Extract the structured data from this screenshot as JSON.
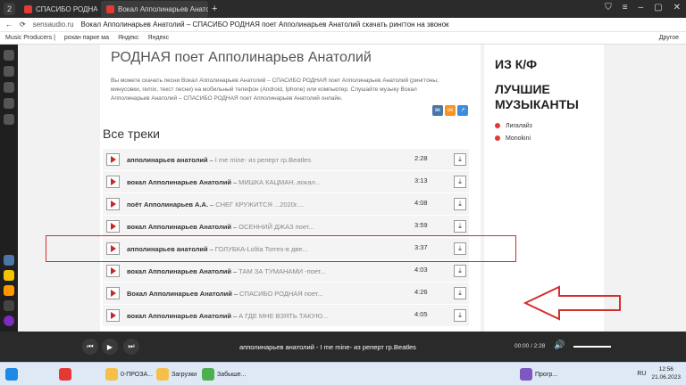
{
  "browser": {
    "tab_count": "2",
    "tabs": [
      {
        "title": "СПАСИБО РОДНАЯ поет Апполинарьев..."
      },
      {
        "title": "Вокал Апполинарьев Анатолий"
      }
    ],
    "address": {
      "host": "sensaudio.ru",
      "title": "Вокал Апполинарьев Анатолий – СПАСИБО РОДНАЯ поет Апполинарьев Анатолий скачать рингтон на звонок"
    },
    "bookmarks": [
      "Music Producers |",
      "рохан парке ма",
      "Яндекс",
      "Яндекс"
    ],
    "bookmarks_other": "Другое"
  },
  "page": {
    "heading": "РОДНАЯ поет Апполинарьев Анатолий",
    "description": "Вы можете скачать песни Вокал Апполинарьев Анатолий – СПАСИБО РОДНАЯ поет Апполинарьев Анатолий (рингтоны, минусовки, remix, текст песни) на мобильный телефон (Android, Iphone) или компьютер. Слушайте музыку Вокал Апполинарьев Анатолий – СПАСИБО РОДНАЯ поет Апполинарьев Анатолий онлайн.",
    "section_title": "Все треки",
    "tracks": [
      {
        "artist": "апполинарьев анатолий",
        "title": "I me mine- из реперт гр.Beatles",
        "duration": "2:28"
      },
      {
        "artist": "вокал Апполинарьев Анатолий",
        "title": "МИШКА КАЦМАН..вокал...",
        "duration": "3:13"
      },
      {
        "artist": "поёт Апполинарьев А.А.",
        "title": "СНЕГ КРУЖИТСЯ ...2020г....",
        "duration": "4:08"
      },
      {
        "artist": "вокал Апполинарьев Анатолий",
        "title": "ОСЕННИЙ ДЖАЗ поет...",
        "duration": "3:59"
      },
      {
        "artist": "апполинарьев анатолий",
        "title": "ГОЛУБКА-Lolita Torres-в две...",
        "duration": "3:37"
      },
      {
        "artist": "вокал Апполинарьев Анатолий",
        "title": "ТАМ ЗА ТУМАНАМИ -поет...",
        "duration": "4:03"
      },
      {
        "artist": "Вокал Апполинарьев Анатолий",
        "title": "СПАСИБО РОДНАЯ поет...",
        "duration": "4:26"
      },
      {
        "artist": "вокал Апполинарьев Анатолий",
        "title": "А ГДЕ МНЕ ВЗЯТЬ ТАКУЮ...",
        "duration": "4:05"
      }
    ],
    "sidebar": {
      "title1": "ИЗ К/Ф",
      "title2": "ЛУЧШИЕ МУЗЫКАНТЫ",
      "items": [
        "Лигалайз",
        "Monokini"
      ]
    }
  },
  "player": {
    "now_playing": "апполинарьев анатолий - I me mine- из реперт гр.Beatles",
    "time": "00:00 / 2:28"
  },
  "taskbar": {
    "items": [
      "0-ПРОЗА...",
      "Загрузки",
      "Забыше...",
      "Прогр..."
    ],
    "lang": "RU",
    "time": "12:56",
    "date": "21.06.2023"
  },
  "colors": {
    "accent": "#c62828",
    "highlight": "#d32f2f"
  }
}
